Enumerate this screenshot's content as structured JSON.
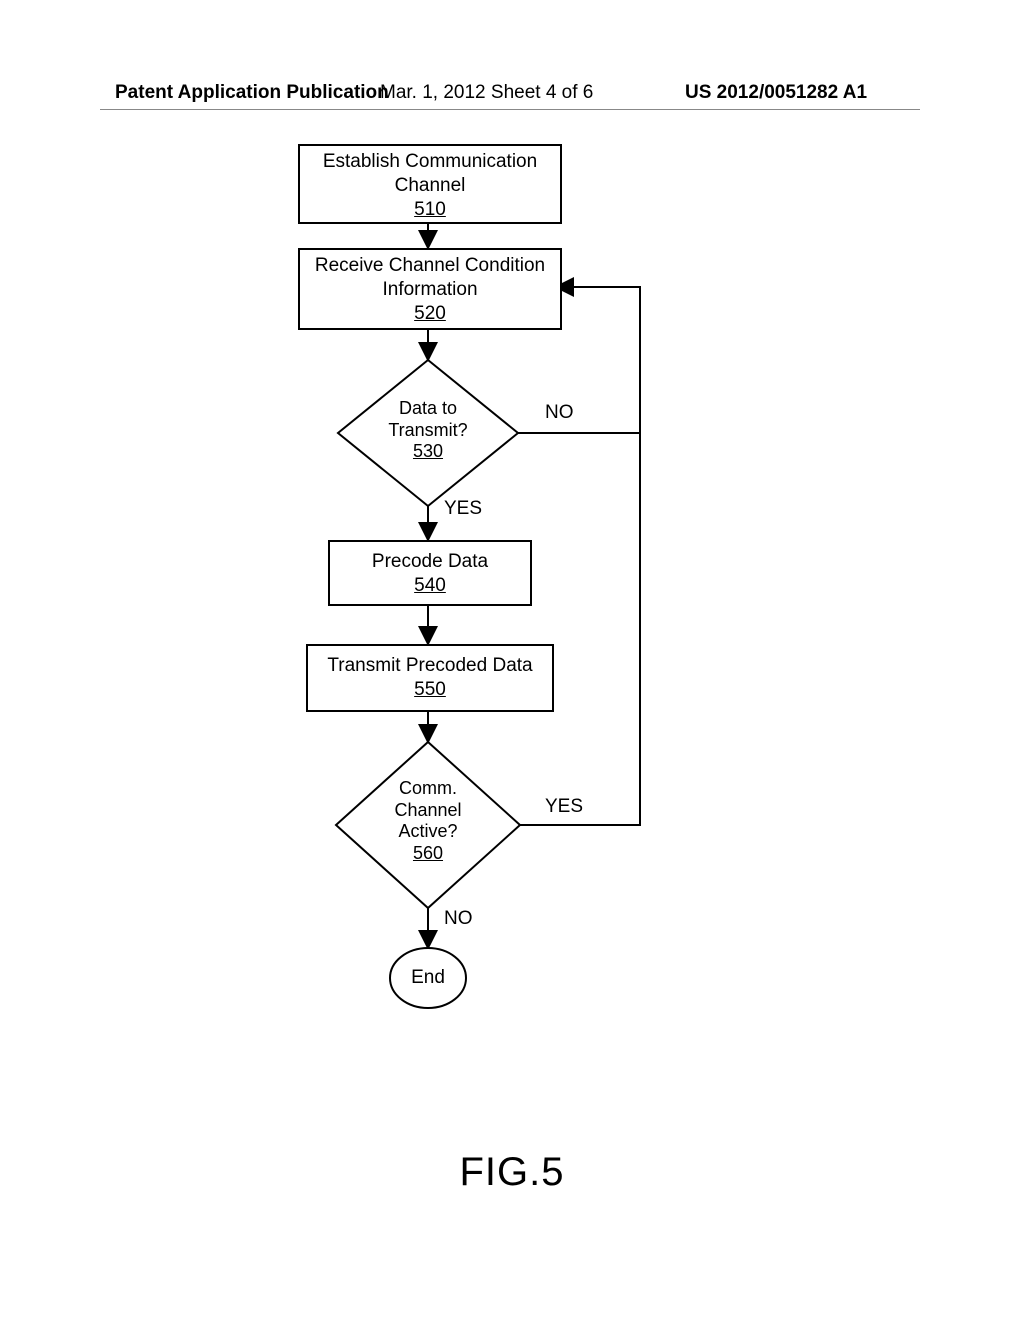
{
  "header": {
    "left": "Patent Application Publication",
    "mid": "Mar. 1, 2012   Sheet 4 of 6",
    "right": "US 2012/0051282 A1"
  },
  "figure_label": "FIG.5",
  "nodes": {
    "n510": {
      "line1": "Establish Communication",
      "line2": "Channel",
      "num": "510"
    },
    "n520": {
      "line1": "Receive Channel Condition",
      "line2": "Information",
      "num": "520"
    },
    "n530": {
      "line1": "Data to",
      "line2": "Transmit?",
      "num": "530"
    },
    "n540": {
      "line1": "Precode Data",
      "num": "540"
    },
    "n550": {
      "line1": "Transmit Precoded Data",
      "num": "550"
    },
    "n560": {
      "line1": "Comm.",
      "line2": "Channel",
      "line3": "Active?",
      "num": "560"
    },
    "end": {
      "label": "End"
    }
  },
  "edges": {
    "d530_no": "NO",
    "d530_yes": "YES",
    "d560_yes": "YES",
    "d560_no": "NO"
  }
}
